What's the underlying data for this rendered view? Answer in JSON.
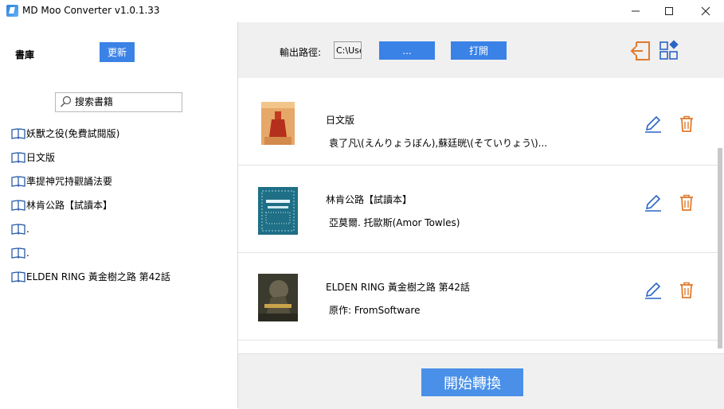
{
  "window": {
    "title": "MD Moo Converter v1.0.1.33",
    "controls": [
      "minimize-icon",
      "maximize-icon",
      "close-icon"
    ]
  },
  "sidebar": {
    "title": "書庫",
    "refresh_label": "更新",
    "search_placeholder": "搜索書籍",
    "books": [
      {
        "label": "妖獸之役(免費試閱版)"
      },
      {
        "label": "日文版"
      },
      {
        "label": "準提神咒持觀誦法要"
      },
      {
        "label": "林肯公路【試讀本】"
      },
      {
        "label": "."
      },
      {
        "label": "."
      },
      {
        "label": "ELDEN RING 黃金樹之路 第42話"
      }
    ]
  },
  "toolbar": {
    "output_path_label": "輸出路徑:",
    "output_path_value": "C:\\Users",
    "browse_label": "...",
    "open_label": "打開",
    "icons": [
      "exit-icon",
      "apps-icon"
    ]
  },
  "queue": [
    {
      "title": "日文版",
      "author": "袁了凡\\(えんりょうぼん),蘇廷晄\\(そていりょう\\)..."
    },
    {
      "title": "林肯公路【試讀本】",
      "author": "亞莫爾. 托歐斯(Amor Towles)"
    },
    {
      "title": "ELDEN RING 黃金樹之路 第42話",
      "author": "原作: FromSoftware"
    }
  ],
  "footer": {
    "start_label": "開始轉換"
  },
  "colors": {
    "accent": "#3b82e6",
    "orange": "#e07a2e",
    "panel": "#f0f0f0"
  }
}
